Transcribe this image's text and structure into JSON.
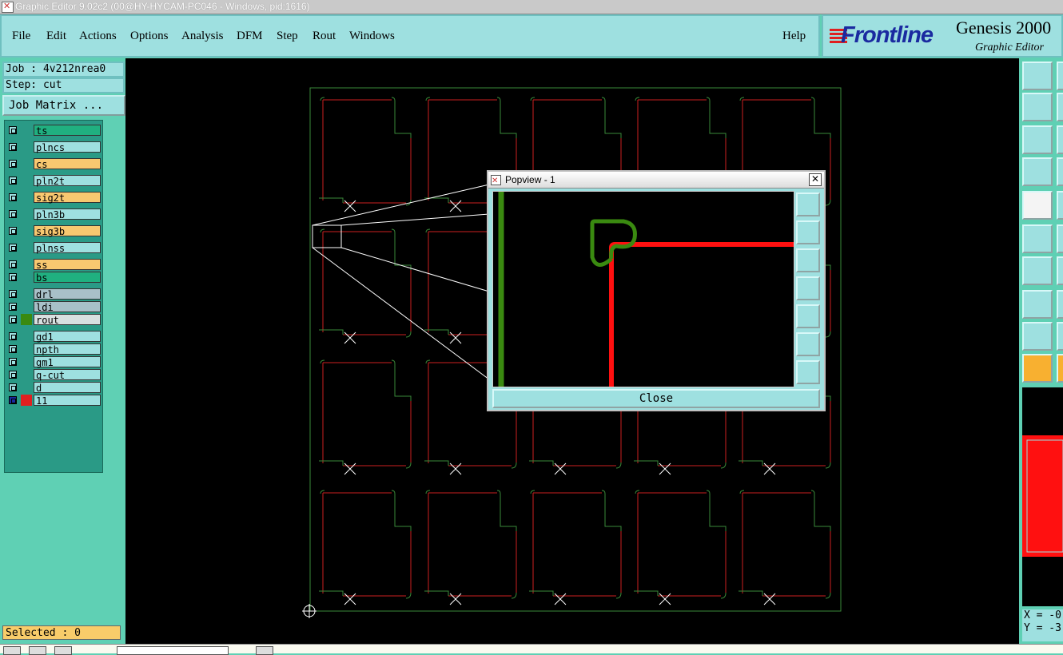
{
  "window": {
    "title": "Graphic Editor 9.02c2 (00@HY-HYCAM-PC046 - Windows, pid:1616)"
  },
  "menu": {
    "items": [
      {
        "label": "File"
      },
      {
        "label": "Edit"
      },
      {
        "label": "Actions"
      },
      {
        "label": "Options"
      },
      {
        "label": "Analysis"
      },
      {
        "label": "DFM"
      },
      {
        "label": "Step"
      },
      {
        "label": "Rout"
      },
      {
        "label": "Windows"
      }
    ],
    "help": "Help"
  },
  "brand": {
    "logo": "Frontline",
    "product": "Genesis 2000",
    "subtitle": "Graphic Editor"
  },
  "job": {
    "job_label": "Job : 4v212nrea0",
    "step_label": "Step: cut",
    "matrix_button": "Job Matrix ..."
  },
  "layers": [
    {
      "name": "ts",
      "color": "#20b080"
    },
    {
      "name": "plncs",
      "color": "#9ee0e0"
    },
    {
      "name": "cs",
      "color": "#f8c870"
    },
    {
      "name": "pln2t",
      "color": "#9ee0e0"
    },
    {
      "name": "sig2t",
      "color": "#f8c870"
    },
    {
      "name": "pln3b",
      "color": "#9ee0e0"
    },
    {
      "name": "sig3b",
      "color": "#f8c870"
    },
    {
      "name": "plnss",
      "color": "#9ee0e0"
    },
    {
      "name": "ss",
      "color": "#f8c870"
    },
    {
      "name": "bs",
      "color": "#20b080"
    },
    {
      "name": "drl",
      "color": "#a8c0c8"
    },
    {
      "name": "ldi",
      "color": "#a8c0c8"
    },
    {
      "name": "rout",
      "color": "#d8e0e0",
      "swatch": "#3a8a10"
    },
    {
      "name": "gd1",
      "color": "#9ee0e0"
    },
    {
      "name": "npth",
      "color": "#9ee0e0"
    },
    {
      "name": "gm1",
      "color": "#9ee0e0"
    },
    {
      "name": "q-cut",
      "color": "#9ee0e0"
    },
    {
      "name": "d",
      "color": "#9ee0e0"
    },
    {
      "name": "11",
      "color": "#9ee0e0",
      "swatch": "#e02020",
      "active": true
    }
  ],
  "status": {
    "selected": "Selected : 0"
  },
  "popview": {
    "title": "Popview - 1",
    "close_button": "Close",
    "close_x": "✕"
  },
  "coords": {
    "x_label": "X = -0",
    "y_label": "Y = -3"
  },
  "colors": {
    "profile": "#3a8a3a",
    "rout_path": "#cc2020",
    "rout_green": "#3a8a10",
    "zoom_red": "#ff1010"
  }
}
